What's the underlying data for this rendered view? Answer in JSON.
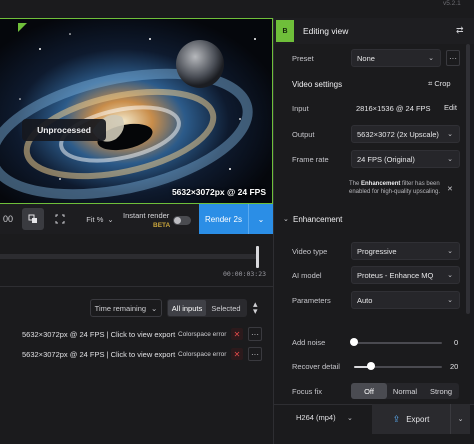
{
  "app": {
    "version": "v5.2.1"
  },
  "preview": {
    "badge": "Unprocessed",
    "resolution": "5632×3072px @ 24 FPS"
  },
  "toolbar": {
    "split_label": "00",
    "fit_label": "Fit %",
    "instant_render_label": "Instant render",
    "beta_label": "BETA",
    "render_label": "Render 2s"
  },
  "timeline": {
    "timecode": "00:00:03:23",
    "position": 0.99
  },
  "queue": {
    "sort_label": "Time remaining",
    "filter_all": "All inputs",
    "filter_selected": "Selected",
    "jobs": [
      {
        "text": "5632×3072px @ 24 FPS | Click to view export",
        "status": "Colorspace error"
      },
      {
        "text": "5632×3072px @ 24 FPS | Click to view export",
        "status": "Colorspace error"
      }
    ]
  },
  "editing": {
    "tab_badge": "B",
    "title": "Editing view",
    "preset_label": "Preset",
    "preset_value": "None",
    "video_settings_title": "Video settings",
    "crop_label": "Crop",
    "input_label": "Input",
    "input_value": "2816×1536 @ 24 FPS",
    "edit_label": "Edit",
    "output_label": "Output",
    "output_value": "5632×3072 (2x Upscale)",
    "frame_rate_label": "Frame rate",
    "frame_rate_value": "24 FPS (Original)",
    "note_prefix": "The ",
    "note_bold": "Enhancement",
    "note_suffix": " filter has been enabled for high-quality upscaling."
  },
  "enhancement": {
    "title": "Enhancement",
    "video_type_label": "Video type",
    "video_type_value": "Progressive",
    "ai_model_label": "AI model",
    "ai_model_value": "Proteus - Enhance MQ",
    "parameters_label": "Parameters",
    "parameters_value": "Auto",
    "add_noise_label": "Add noise",
    "add_noise_value": "0",
    "recover_detail_label": "Recover detail",
    "recover_detail_value": "20",
    "focus_fix_label": "Focus fix",
    "focus_fix_options": [
      "Off",
      "Normal",
      "Strong"
    ],
    "focus_fix_selected": "Off"
  },
  "export": {
    "format_value": "H264 (mp4)",
    "export_label": "Export"
  },
  "colors": {
    "accent_green": "#6fbf3a",
    "render_blue": "#2b8ee6",
    "error_red": "#e24a4a"
  }
}
